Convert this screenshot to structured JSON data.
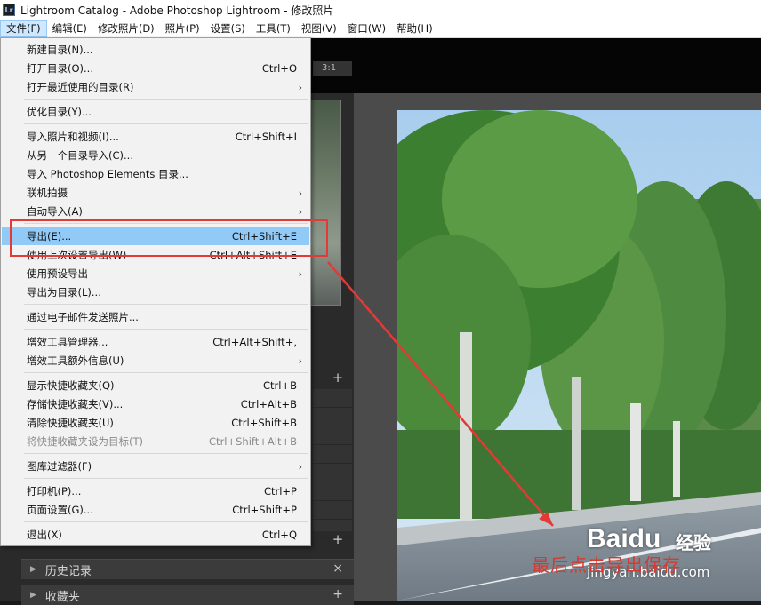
{
  "window": {
    "title": "Lightroom Catalog - Adobe Photoshop Lightroom - 修改照片",
    "logo": "Lr"
  },
  "menubar": [
    {
      "label": "文件(F)",
      "active": true
    },
    {
      "label": "编辑(E)"
    },
    {
      "label": "修改照片(D)"
    },
    {
      "label": "照片(P)"
    },
    {
      "label": "设置(S)"
    },
    {
      "label": "工具(T)"
    },
    {
      "label": "视图(V)"
    },
    {
      "label": "窗口(W)"
    },
    {
      "label": "帮助(H)"
    }
  ],
  "file_menu": {
    "items": {
      "new_catalog": {
        "label": "新建目录(N)..."
      },
      "open_catalog": {
        "label": "打开目录(O)...",
        "shortcut": "Ctrl+O"
      },
      "open_recent": {
        "label": "打开最近使用的目录(R)",
        "arrow": "›"
      },
      "optimize": {
        "label": "优化目录(Y)..."
      },
      "import_photos": {
        "label": "导入照片和视频(I)...",
        "shortcut": "Ctrl+Shift+I"
      },
      "import_from_catalog": {
        "label": "从另一个目录导入(C)..."
      },
      "import_pse": {
        "label": "导入 Photoshop Elements 目录..."
      },
      "tethered": {
        "label": "联机拍摄",
        "arrow": "›"
      },
      "auto_import": {
        "label": "自动导入(A)",
        "arrow": "›"
      },
      "export": {
        "label": "导出(E)...",
        "shortcut": "Ctrl+Shift+E"
      },
      "export_previous": {
        "label": "使用上次设置导出(W)",
        "shortcut": "Ctrl+Alt+Shift+E"
      },
      "export_preset": {
        "label": "使用预设导出",
        "arrow": "›"
      },
      "export_as_catalog": {
        "label": "导出为目录(L)..."
      },
      "email": {
        "label": "通过电子邮件发送照片..."
      },
      "plugin_manager": {
        "label": "增效工具管理器...",
        "shortcut": "Ctrl+Alt+Shift+,"
      },
      "plugin_extras": {
        "label": "增效工具额外信息(U)",
        "arrow": "›"
      },
      "show_quick_collection": {
        "label": "显示快捷收藏夹(Q)",
        "shortcut": "Ctrl+B"
      },
      "save_quick_collection": {
        "label": "存储快捷收藏夹(V)...",
        "shortcut": "Ctrl+Alt+B"
      },
      "clear_quick_collection": {
        "label": "清除快捷收藏夹(U)",
        "shortcut": "Ctrl+Shift+B"
      },
      "set_quick_target": {
        "label": "将快捷收藏夹设为目标(T)",
        "shortcut": "Ctrl+Shift+Alt+B"
      },
      "library_filters": {
        "label": "图库过滤器(F)",
        "arrow": "›"
      },
      "print": {
        "label": "打印机(P)...",
        "shortcut": "Ctrl+P"
      },
      "page_setup": {
        "label": "页面设置(G)...",
        "shortcut": "Ctrl+Shift+P"
      },
      "exit": {
        "label": "退出(X)",
        "shortcut": "Ctrl+Q"
      }
    }
  },
  "navigator": {
    "zoom": "3:1"
  },
  "panels": {
    "history": {
      "title": "历史记录",
      "action": "×"
    },
    "collections": {
      "title": "收藏夹",
      "action": "+"
    }
  },
  "plus": "+",
  "annotation": {
    "caption": "最后点击导出保存",
    "color": "#e53935"
  },
  "watermark": {
    "logo": "Baidu",
    "text": "经验",
    "url": "jingyan.baidu.com"
  }
}
